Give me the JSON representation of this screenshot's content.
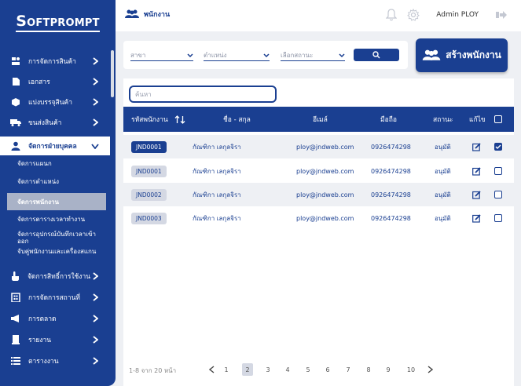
{
  "brand": {
    "logo_first": "S",
    "logo_rest": "OFTPROMPT"
  },
  "sidebar": {
    "items": [
      {
        "label": "การจัดการสินค้า"
      },
      {
        "label": "เอกสาร"
      },
      {
        "label": "แบ่งบรรจุสินค้า"
      },
      {
        "label": "ขนส่งสินค้า"
      },
      {
        "label": "จัดการฝ่ายบุคคล"
      },
      {
        "label": "จัดการสิทธิ์การใช้งาน"
      },
      {
        "label": "การจัดการสถานที่"
      },
      {
        "label": "การตลาด"
      },
      {
        "label": "รายงาน"
      },
      {
        "label": "ตารางงาน"
      }
    ],
    "submenu": [
      {
        "label": "จัดการแผนก"
      },
      {
        "label": "จัดการตำแหน่ง"
      },
      {
        "label": "จัดการพนักงาน"
      },
      {
        "label": "จัดการตารางเวลาทำงาน"
      },
      {
        "label": "จัดการอุปกรณ์บันทึกเวลาเข้าออก"
      },
      {
        "label": "จับคู่พนักงานและเครื่องสแกน"
      }
    ]
  },
  "header": {
    "title": "พนักงาน",
    "admin": "Admin PLOY"
  },
  "filters": {
    "branch": "สาขา",
    "position": "ตำแหน่ง",
    "status": "เลือกสถานะ"
  },
  "create_label": "สร้างพนักงาน",
  "search": {
    "placeholder": "ค้นหา"
  },
  "table": {
    "headers": {
      "code": "รหัสพนักงาน",
      "name": "ชื่อ - สกุล",
      "email": "อีเมล์",
      "phone": "มือถือ",
      "status": "สถานะ",
      "edit": "แก้ไข"
    },
    "rows": [
      {
        "code": "JND0001",
        "name": "กัณฑิกา เลกุลจิรา",
        "email": "ploy@jndweb.com",
        "phone": "0926474298",
        "status": "อนุมัติ"
      },
      {
        "code": "JND0001",
        "name": "กัณฑิกา เลกุลจิรา",
        "email": "ploy@jndweb.com",
        "phone": "0926474298",
        "status": "อนุมัติ"
      },
      {
        "code": "JND0002",
        "name": "กัณฑิกา เลกุลจิรา",
        "email": "ploy@jndweb.com",
        "phone": "0926474298",
        "status": "อนุมัติ"
      },
      {
        "code": "JND0003",
        "name": "กัณฑิกา เลกุลจิรา",
        "email": "ploy@jndweb.com",
        "phone": "0926474298",
        "status": "อนุมัติ"
      }
    ]
  },
  "pagination": {
    "info": "1-8 จาก 20 หน้า",
    "pages": [
      "1",
      "2",
      "3",
      "4",
      "5",
      "6",
      "7",
      "8",
      "9",
      "10"
    ]
  },
  "colors": {
    "primary": "#1a3f91",
    "panel": "#eef0f4",
    "badge": "#d4d8e3"
  }
}
